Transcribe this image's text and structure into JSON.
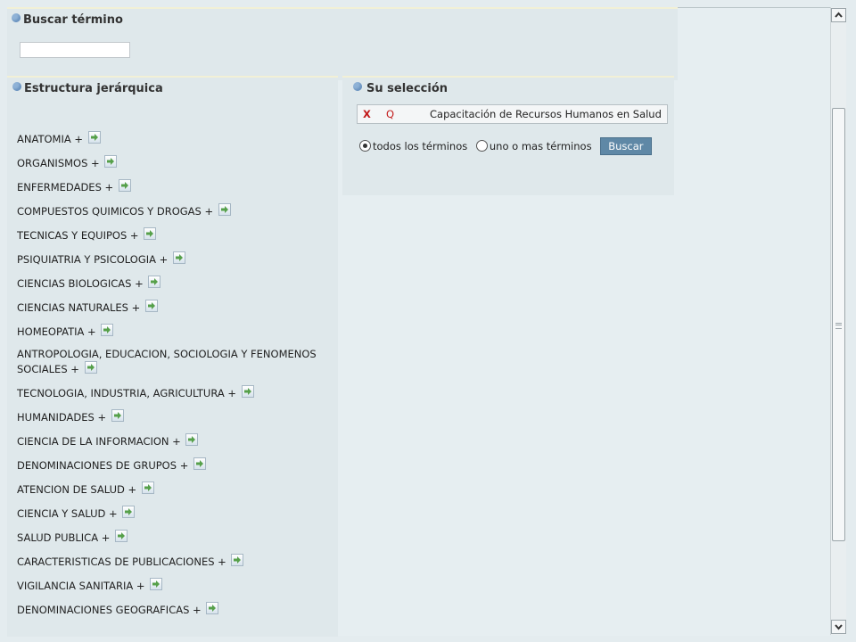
{
  "search": {
    "title": "Buscar término",
    "input_value": "",
    "input_placeholder": ""
  },
  "tree": {
    "title": "Estructura jerárquica",
    "items": [
      {
        "label": "ANATOMIA +"
      },
      {
        "label": "ORGANISMOS +"
      },
      {
        "label": "ENFERMEDADES +"
      },
      {
        "label": "COMPUESTOS QUIMICOS Y DROGAS +"
      },
      {
        "label": "TECNICAS Y EQUIPOS +"
      },
      {
        "label": "PSIQUIATRIA Y PSICOLOGIA +"
      },
      {
        "label": "CIENCIAS BIOLOGICAS +"
      },
      {
        "label": "CIENCIAS NATURALES +"
      },
      {
        "label": "HOMEOPATIA +"
      },
      {
        "label": "ANTROPOLOGIA, EDUCACION, SOCIOLOGIA Y FENOMENOS SOCIALES +"
      },
      {
        "label": "TECNOLOGIA, INDUSTRIA, AGRICULTURA +"
      },
      {
        "label": "HUMANIDADES +"
      },
      {
        "label": "CIENCIA DE LA INFORMACION +"
      },
      {
        "label": "DENOMINACIONES DE GRUPOS +"
      },
      {
        "label": "ATENCION DE SALUD +"
      },
      {
        "label": "CIENCIA Y SALUD +"
      },
      {
        "label": "SALUD PUBLICA +"
      },
      {
        "label": "CARACTERISTICAS DE PUBLICACIONES +"
      },
      {
        "label": "VIGILANCIA SANITARIA +"
      },
      {
        "label": "DENOMINACIONES GEOGRAFICAS +"
      }
    ],
    "icon": "add-arrow-icon"
  },
  "selection": {
    "title": "Su selección",
    "remove_label": "X",
    "query_label": "Q",
    "term": "Capacitación de Recursos Humanos en Salud",
    "option_all": "todos los términos",
    "option_any": "uno o mas términos",
    "selected_option": "todos los términos",
    "search_button": "Buscar"
  },
  "colors": {
    "accent": "#5f88a6",
    "remove": "#c21a1a",
    "panel_bg": "#dfe8eb"
  }
}
